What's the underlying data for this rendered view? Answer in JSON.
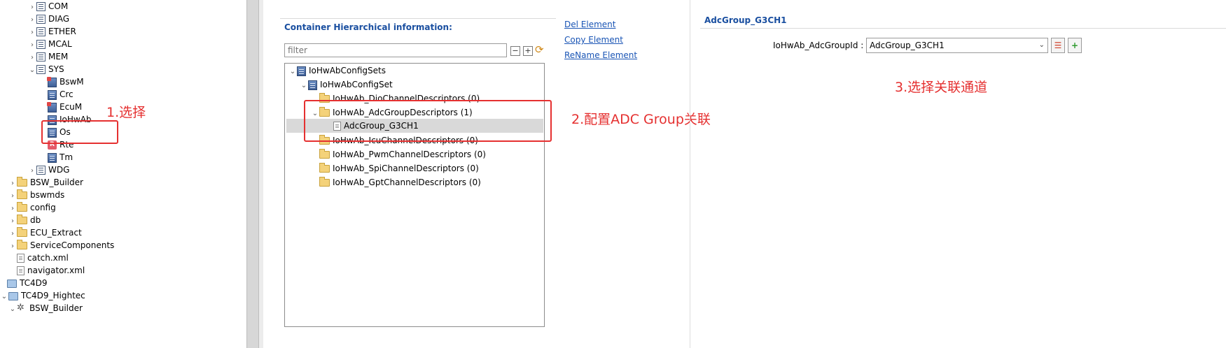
{
  "left_tree": {
    "items": [
      {
        "label": "COM",
        "icon": "grid-icon"
      },
      {
        "label": "DIAG",
        "icon": "grid-icon"
      },
      {
        "label": "ETHER",
        "icon": "grid-icon"
      },
      {
        "label": "MCAL",
        "icon": "grid-icon"
      },
      {
        "label": "MEM",
        "icon": "grid-icon"
      },
      {
        "label": "SYS",
        "icon": "grid-icon"
      },
      {
        "label": "BswM",
        "icon": "module-icon"
      },
      {
        "label": "Crc",
        "icon": "module-icon"
      },
      {
        "label": "EcuM",
        "icon": "module-icon"
      },
      {
        "label": "IoHwAb",
        "icon": "module-icon"
      },
      {
        "label": "Os",
        "icon": "module-icon"
      },
      {
        "label": "Rte",
        "icon": "rte-icon"
      },
      {
        "label": "Tm",
        "icon": "module-icon"
      },
      {
        "label": "WDG",
        "icon": "grid-icon"
      },
      {
        "label": "BSW_Builder",
        "icon": "folder-icon"
      },
      {
        "label": "bswmds",
        "icon": "folder-icon"
      },
      {
        "label": "config",
        "icon": "folder-icon"
      },
      {
        "label": "db",
        "icon": "folder-icon"
      },
      {
        "label": "ECU_Extract",
        "icon": "folder-icon"
      },
      {
        "label": "ServiceComponents",
        "icon": "folder-icon"
      },
      {
        "label": "catch.xml",
        "icon": "file-icon"
      },
      {
        "label": "navigator.xml",
        "icon": "file-icon"
      },
      {
        "label": "TC4D9",
        "icon": "project-icon"
      },
      {
        "label": "TC4D9_Hightec",
        "icon": "project-icon"
      },
      {
        "label": "BSW_Builder",
        "icon": "gear-icon"
      }
    ]
  },
  "center": {
    "title": "Container Hierarchical information:",
    "filter_placeholder": "filter",
    "links": {
      "delete": "Del Element",
      "copy": "Copy Element",
      "rename": "ReName Element"
    },
    "tree": [
      {
        "label": "IoHwAbConfigSets"
      },
      {
        "label": "IoHwAbConfigSet"
      },
      {
        "label": "IoHwAb_DioChannelDescriptors (0)"
      },
      {
        "label": "IoHwAb_AdcGroupDescriptors (1)"
      },
      {
        "label": "AdcGroup_G3CH1"
      },
      {
        "label": "IoHwAb_IcuChannelDescriptors (0)"
      },
      {
        "label": "IoHwAb_PwmChannelDescriptors (0)"
      },
      {
        "label": "IoHwAb_SpiChannelDescriptors (0)"
      },
      {
        "label": "IoHwAb_GptChannelDescriptors (0)"
      }
    ]
  },
  "right": {
    "title": "AdcGroup_G3CH1",
    "field_label": "IoHwAb_AdcGroupId :",
    "field_value": "AdcGroup_G3CH1"
  },
  "annotations": {
    "step1": "1.选择",
    "step2": "2.配置ADC Group关联",
    "step3": "3.选择关联通道"
  },
  "colors": {
    "accent_title": "#1a4fa0",
    "annotation": "#e53030",
    "link": "#1a55b5"
  }
}
